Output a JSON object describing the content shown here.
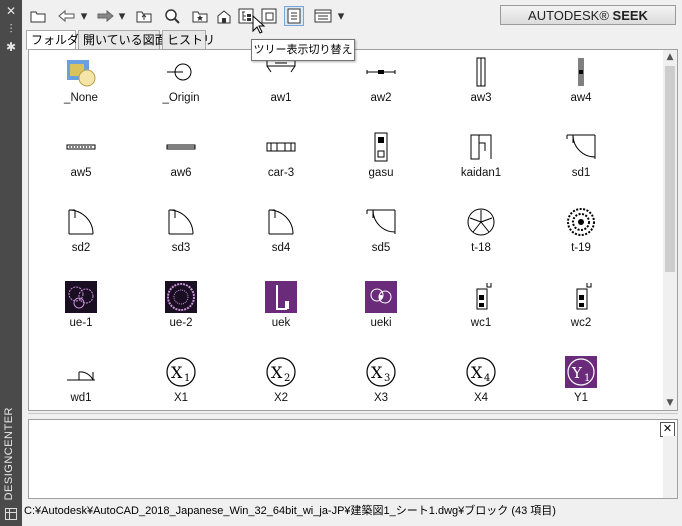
{
  "sidebar": {
    "label": "DESIGNCENTER",
    "icons": [
      "close-icon",
      "autohide-icon",
      "properties-icon"
    ]
  },
  "toolbar": {
    "buttons": [
      "load-icon",
      "back-icon",
      "back-dropdown-icon",
      "forward-icon",
      "forward-dropdown-icon",
      "up-icon",
      "search-icon",
      "favorites-icon",
      "home-icon",
      "tree-toggle-icon",
      "preview-icon",
      "description-icon",
      "views-icon",
      "views-dropdown-icon"
    ],
    "seek_label": "AUTODESK",
    "seek_label_bold": "SEEK"
  },
  "tabs": [
    "フォルダ",
    "開いている図面",
    "ヒストリ"
  ],
  "tooltip": "ツリー表示切り替え",
  "items": [
    {
      "label": "_None",
      "icon": "block-default-icon"
    },
    {
      "label": "_Origin",
      "icon": "origin-icon"
    },
    {
      "label": "aw1",
      "icon": "aw1-icon"
    },
    {
      "label": "aw2",
      "icon": "aw2-icon"
    },
    {
      "label": "aw3",
      "icon": "aw3-icon"
    },
    {
      "label": "aw4",
      "icon": "aw4-icon"
    },
    {
      "label": "aw5",
      "icon": "aw5-icon"
    },
    {
      "label": "aw6",
      "icon": "aw6-icon"
    },
    {
      "label": "car-3",
      "icon": "car-icon"
    },
    {
      "label": "gasu",
      "icon": "gasu-icon"
    },
    {
      "label": "kaidan1",
      "icon": "stairs-icon"
    },
    {
      "label": "sd1",
      "icon": "door-icon"
    },
    {
      "label": "sd2",
      "icon": "door-icon"
    },
    {
      "label": "sd3",
      "icon": "door-icon"
    },
    {
      "label": "sd4",
      "icon": "door-icon"
    },
    {
      "label": "sd5",
      "icon": "door-icon"
    },
    {
      "label": "t-18",
      "icon": "tree-icon"
    },
    {
      "label": "t-19",
      "icon": "tree-icon"
    },
    {
      "label": "ue-1",
      "icon": "planting-dark-icon"
    },
    {
      "label": "ue-2",
      "icon": "planting-dark-icon"
    },
    {
      "label": "uek",
      "icon": "planting-purple-icon"
    },
    {
      "label": "ueki",
      "icon": "planting-purple-icon"
    },
    {
      "label": "wc1",
      "icon": "toilet-icon"
    },
    {
      "label": "wc2",
      "icon": "toilet-icon"
    },
    {
      "label": "wd1",
      "icon": "window-icon"
    },
    {
      "label": "X1",
      "icon": "grid-symbol-icon"
    },
    {
      "label": "X2",
      "icon": "grid-symbol-icon"
    },
    {
      "label": "X3",
      "icon": "grid-symbol-icon"
    },
    {
      "label": "X4",
      "icon": "grid-symbol-icon"
    },
    {
      "label": "Y1",
      "icon": "grid-symbol-purple-icon"
    }
  ],
  "status": "C:¥Autodesk¥AutoCAD_2018_Japanese_Win_32_64bit_wi_ja-JP¥建築図1_シート1.dwg¥ブロック (43 項目)",
  "colors": {
    "sidebar": "#4a4a4a",
    "purple": "#6a2c7a",
    "dark": "#1a0f22",
    "pressed": "#dbe8f6"
  }
}
